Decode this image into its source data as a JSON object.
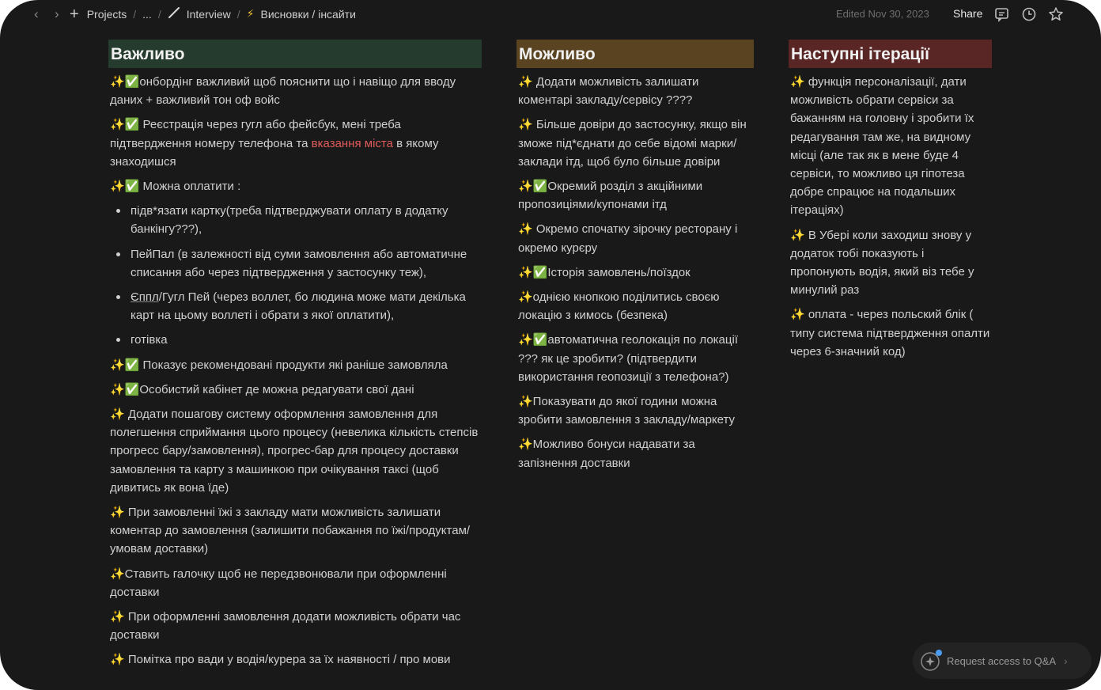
{
  "topbar": {
    "breadcrumbs": [
      {
        "label": "Projects"
      },
      {
        "label": "..."
      },
      {
        "label": "Interview"
      },
      {
        "label": "Висновки / інсайти"
      }
    ],
    "edited": "Edited Nov 30, 2023",
    "share_label": "Share",
    "icons": [
      "back-arrow-icon",
      "forward-arrow-icon",
      "plus-icon",
      "comments-icon",
      "history-icon",
      "favorite-star-icon"
    ]
  },
  "columns": {
    "important": {
      "title": "Важливо",
      "color": "#243b2d",
      "items": [
        "✨✅онбордінг важливий щоб пояснити що і навіщо для вводу даних + важливий тон оф войс",
        "✨✅ Реєстрація через гугл або фейсбук, мені треба підтвердження номеру телефона та",
        "вказання міста",
        "в якому знаходишся",
        "✨✅ Можна оплатити :",
        "підв*язати картку(треба підтверджувати оплату в додатку банкінгу???),",
        "ПейПал (в залежності від суми замовлення або автоматичне списання або через підтвердження у застосунку теж),",
        "Єппл",
        "/Гугл Пей (через воллет, бо людина може мати декілька карт на цьому воллеті і обрати з якої оплатити),",
        "готівка",
        "✨✅ Показує рекомендовані продукти які раніше замовляла",
        "✨✅Особистий кабінет де можна редагувати свої дані",
        "✨ Додати пошагову систему оформлення замовлення для полегшення сприймання цього процесу (невелика кількість степсів прогресс бару/замовлення), прогрес-бар для процесу доставки замовлення та карту з машинкою при очікування таксі (щоб дивитись як вона їде)",
        "✨ При замовленні їжі з закладу мати можливість залишати коментар до замовлення (залишити побажання по їжі/продуктам/умовам доставки)",
        "✨Ставить галочку щоб не передзвонювали при оформленні доставки",
        "✨ При оформленні замовлення додати можливість обрати час доставки",
        "✨ Помітка про вади у водія/курера за їх наявності / про мови"
      ]
    },
    "possible": {
      "title": "Можливо",
      "color": "#5a4320",
      "items": [
        "✨ Додати можливість залишати коментарі закладу/сервісу ????",
        "✨ Більше довіри до застосунку, якщо він зможе під*єднати до себе відомі марки/заклади ітд, щоб було більше довіри",
        "✨✅Окремий розділ з акційними пропозиціями/купонами ітд",
        "✨ Окремо спочатку зірочку ресторану і окремо курєру",
        "✨✅Історія замовлень/поїздок",
        "✨однією кнопкою поділитись своєю локацію з кимось (безпека)",
        "✨✅автоматична геолокація по локації ??? як це зробити? (підтвердити використання геопозиції з телефона?)",
        "✨Показувати до якої години можна зробити замовлення з закладу/маркету",
        "✨Можливо бонуси надавати за запізнення доставки"
      ]
    },
    "next": {
      "title": "Наступні ітерації",
      "color": "#5a2525",
      "items": [
        "✨ функція персоналізації, дати можливість обрати сервіси за бажанням на головну і зробити їх редагування там же, на видному місці (але так як в мене буде 4 сервіси, то можливо ця гіпотеза добре спрацює на подальших ітераціях)",
        "✨ В Убері коли заходиш знову у додаток тобі показують і пропонують водія, який віз тебе у минулий раз",
        "✨ оплата - через польский блік ( типу система підтвердження опалти через 6-значний код)"
      ]
    }
  },
  "qa": {
    "label": "Request access to Q&A",
    "icon": "sparkle-ai-icon"
  }
}
